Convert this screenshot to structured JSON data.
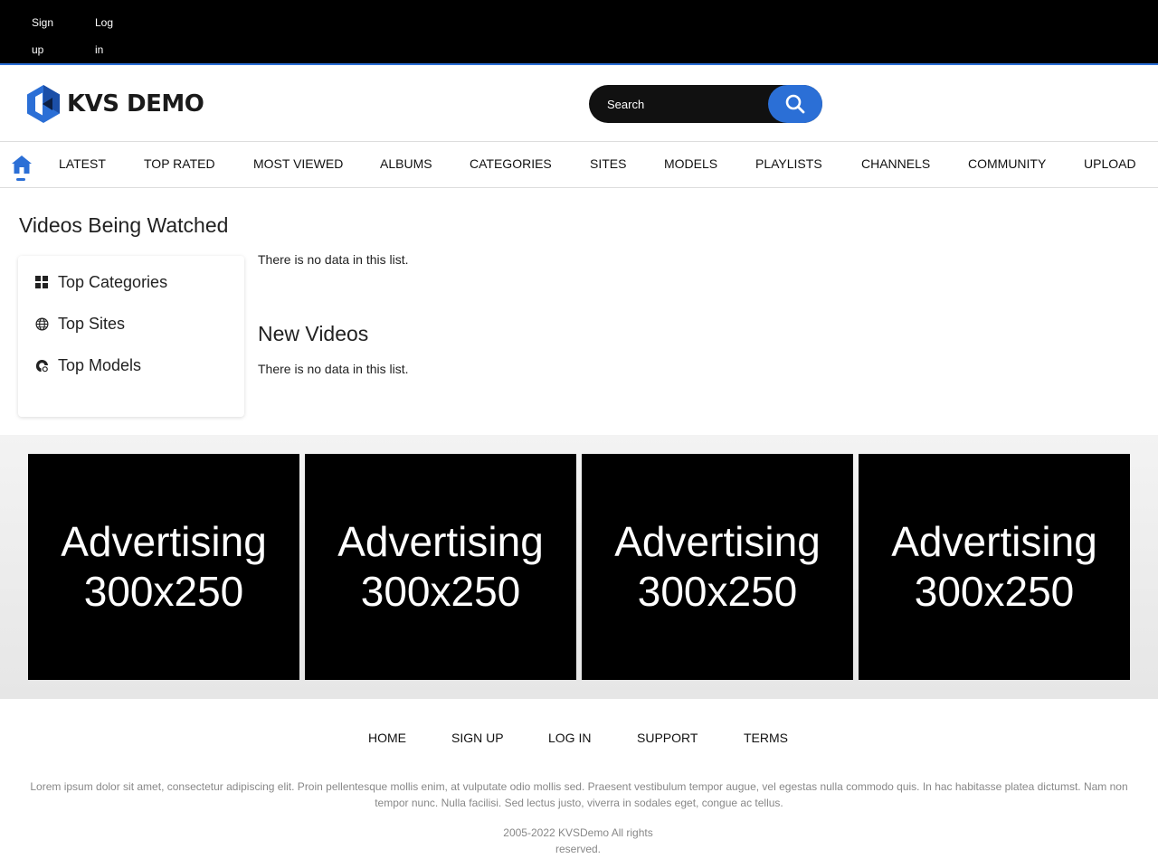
{
  "topbar": {
    "signup_label": "Sign up",
    "login_label": "Log in"
  },
  "header": {
    "logo_text": "KVS DEMO",
    "search_placeholder": "Search",
    "brand_color": "#2b6fd6"
  },
  "nav": {
    "items": [
      "LATEST",
      "TOP RATED",
      "MOST VIEWED",
      "ALBUMS",
      "CATEGORIES",
      "SITES",
      "MODELS",
      "PLAYLISTS",
      "CHANNELS",
      "COMMUNITY",
      "UPLOAD"
    ]
  },
  "main": {
    "section1_title": "Videos Being Watched",
    "section1_empty": "There is no data in this list.",
    "section2_title": "New Videos",
    "section2_empty": "There is no data in this list."
  },
  "sidebar": {
    "items": [
      {
        "label": "Top Categories",
        "icon": "grid-icon"
      },
      {
        "label": "Top Sites",
        "icon": "globe-icon"
      },
      {
        "label": "Top Models",
        "icon": "model-icon"
      }
    ]
  },
  "ads": [
    {
      "line1": "Advertising",
      "line2": "300x250"
    },
    {
      "line1": "Advertising",
      "line2": "300x250"
    },
    {
      "line1": "Advertising",
      "line2": "300x250"
    },
    {
      "line1": "Advertising",
      "line2": "300x250"
    }
  ],
  "footer": {
    "links": [
      "HOME",
      "SIGN UP",
      "LOG IN",
      "SUPPORT",
      "TERMS"
    ],
    "description": "Lorem ipsum dolor sit amet, consectetur adipiscing elit. Proin pellentesque mollis enim, at vulputate odio mollis sed. Praesent vestibulum tempor augue, vel egestas nulla commodo quis. In hac habitasse platea dictumst. Nam non tempor nunc. Nulla facilisi. Sed lectus justo, viverra in sodales eget, congue ac tellus.",
    "copyright": "2005-2022   KVSDemo   All rights reserved."
  }
}
